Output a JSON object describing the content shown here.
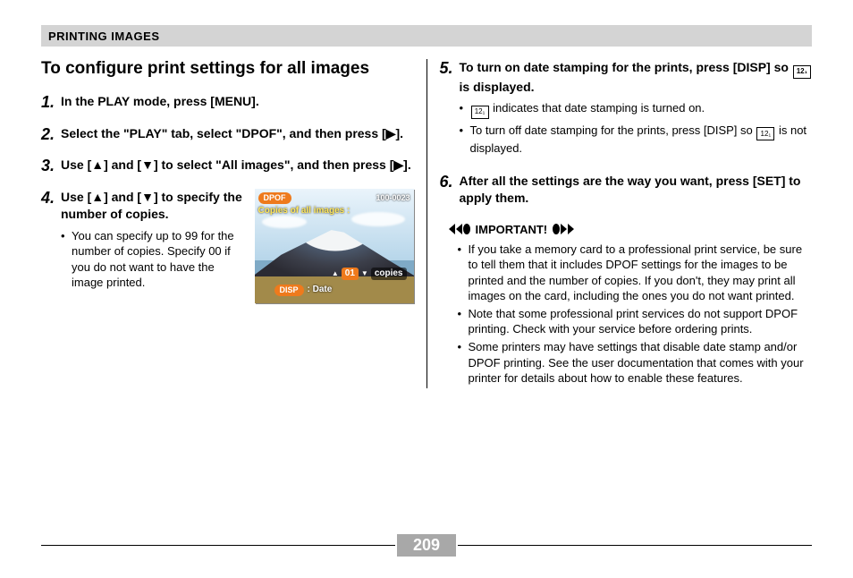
{
  "header": "PRINTING IMAGES",
  "title": "To configure print settings for all images",
  "steps": {
    "s1": {
      "num": "1.",
      "text": "In the PLAY mode, press [MENU]."
    },
    "s2": {
      "num": "2.",
      "text": "Select the \"PLAY\" tab, select \"DPOF\", and then press [▶]."
    },
    "s3": {
      "num": "3.",
      "text": "Use [▲] and [▼] to select \"All images\", and then press [▶]."
    },
    "s4": {
      "num": "4.",
      "text": "Use [▲] and [▼] to specify the number of copies.",
      "sub": "You can specify up to 99 for the number of copies. Specify 00 if you do not want to have the image printed."
    },
    "s5": {
      "num": "5.",
      "text_a": "To turn on date stamping for the prints, press [DISP] so ",
      "text_b": " is displayed.",
      "sub1_a": "",
      "sub1_b": " indicates that date stamping is turned on.",
      "sub2_a": "To turn off date stamping for the prints, press [DISP] so ",
      "sub2_b": " is not displayed."
    },
    "s6": {
      "num": "6.",
      "text": "After all the settings are the way you want, press [SET] to apply them."
    }
  },
  "important": {
    "label": "IMPORTANT!",
    "items": [
      "If you take a memory card to a professional print service, be sure to tell them that it includes DPOF settings for the images to be printed and the number of copies. If you don't, they may print all images on the card, including the ones you do not want printed.",
      "Note that some professional print services do not support DPOF printing. Check with your service before ordering prints.",
      "Some printers may have settings that disable date stamp and/or DPOF printing. See the user documentation that comes with your printer for details about how to enable these features."
    ]
  },
  "screenshot": {
    "dpof": "DPOF",
    "file_no": "100-0023",
    "subtitle": "Copies of all images :",
    "copies_val": "01",
    "copies_lbl": "copies",
    "disp": "DISP",
    "date": ": Date"
  },
  "date_icon_glyph": "12₁",
  "page_number": "209"
}
